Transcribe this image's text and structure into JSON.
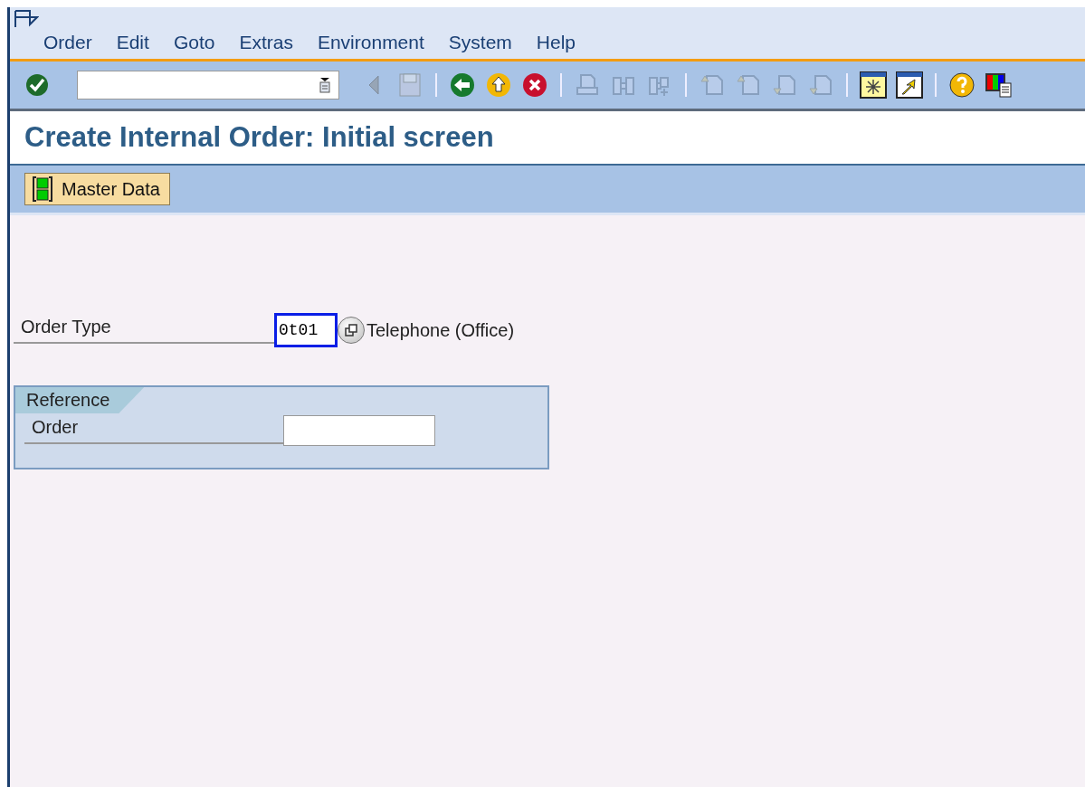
{
  "menu": [
    "Order",
    "Edit",
    "Goto",
    "Extras",
    "Environment",
    "System",
    "Help"
  ],
  "toolbar": [
    {
      "kind": "enter",
      "disabled": false
    },
    {
      "kind": "command_field"
    },
    {
      "kind": "back_small",
      "disabled": true
    },
    {
      "kind": "save",
      "disabled": true
    },
    {
      "kind": "sep"
    },
    {
      "kind": "back",
      "disabled": false
    },
    {
      "kind": "exit",
      "disabled": false
    },
    {
      "kind": "cancel",
      "disabled": false
    },
    {
      "kind": "sep"
    },
    {
      "kind": "print",
      "disabled": true
    },
    {
      "kind": "find",
      "disabled": true
    },
    {
      "kind": "find_next",
      "disabled": true
    },
    {
      "kind": "sep"
    },
    {
      "kind": "first_page",
      "disabled": true
    },
    {
      "kind": "prev_page",
      "disabled": true
    },
    {
      "kind": "next_page",
      "disabled": true
    },
    {
      "kind": "last_page",
      "disabled": true
    },
    {
      "kind": "sep"
    },
    {
      "kind": "new_session",
      "disabled": false
    },
    {
      "kind": "shortcut",
      "disabled": false
    },
    {
      "kind": "sep"
    },
    {
      "kind": "help",
      "disabled": false
    },
    {
      "kind": "layout",
      "disabled": false
    }
  ],
  "title": "Create Internal Order: Initial screen",
  "app_toolbar": [
    {
      "label": "Master Data"
    }
  ],
  "order_type": {
    "label": "Order Type",
    "value": "0t01",
    "focused": true,
    "description": "Telephone (Office)"
  },
  "reference": {
    "title": "Reference",
    "fields": [
      {
        "label": "Order"
      }
    ]
  }
}
